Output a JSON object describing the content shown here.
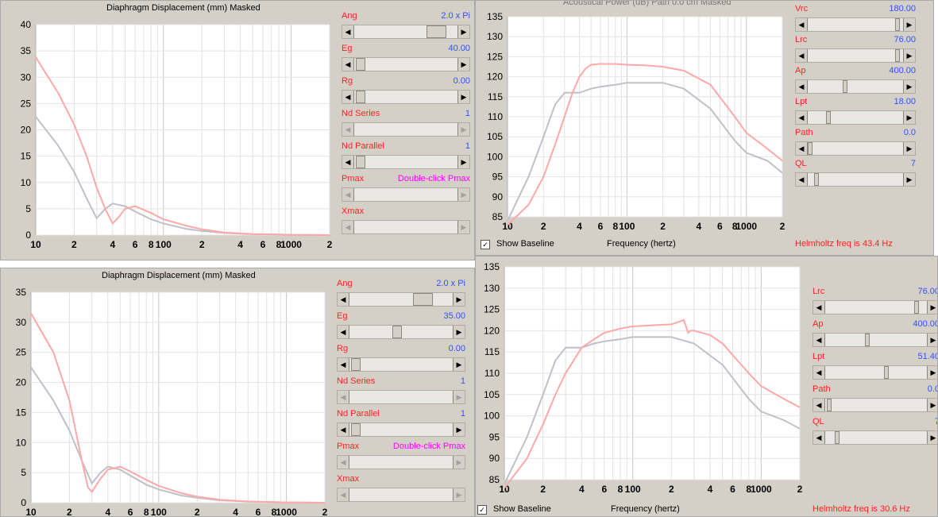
{
  "colors": {
    "baseline": "#c0c0c8",
    "current": "#ffa8a8",
    "label": "#ff2020",
    "value": "#3050ff",
    "magenta": "#ff00ff"
  },
  "xTicks": [
    "10",
    "2",
    "4",
    "6",
    "8",
    "100",
    "2",
    "4",
    "6",
    "8",
    "1000",
    "2"
  ],
  "disp_tl": {
    "title": "Diaphragm Displacement (mm)   Masked",
    "yTicks": [
      "40",
      "35",
      "30",
      "25",
      "20",
      "15",
      "10",
      "5",
      "0"
    ],
    "controls": [
      {
        "label": "Ang",
        "value": "2.0 x Pi"
      },
      {
        "label": "Eg",
        "value": "40.00"
      },
      {
        "label": "Rg",
        "value": "0.00"
      },
      {
        "label": "Nd  Series",
        "value": "1"
      },
      {
        "label": "Nd  Parallel",
        "value": "1"
      },
      {
        "label": "Pmax",
        "value": "Double-click Pmax"
      },
      {
        "label": "Xmax",
        "value": ""
      }
    ]
  },
  "disp_bl": {
    "title": "Diaphragm Displacement (mm)   Masked",
    "yTicks": [
      "35",
      "30",
      "25",
      "20",
      "15",
      "10",
      "5",
      "0"
    ],
    "controls": [
      {
        "label": "Ang",
        "value": "2.0 x Pi"
      },
      {
        "label": "Eg",
        "value": "35.00"
      },
      {
        "label": "Rg",
        "value": "0.00"
      },
      {
        "label": "Nd  Series",
        "value": "1"
      },
      {
        "label": "Nd  Parallel",
        "value": "1"
      },
      {
        "label": "Pmax",
        "value": "Double-click Pmax"
      },
      {
        "label": "Xmax",
        "value": ""
      }
    ]
  },
  "power_tr": {
    "title": "Acoustical Power (dB)   Path 0.0 cm   Masked",
    "yTicks": [
      "135",
      "130",
      "125",
      "120",
      "115",
      "110",
      "105",
      "100",
      "95",
      "90",
      "85"
    ],
    "xlabel": "Frequency (hertz)",
    "baseline_label": "Show Baseline",
    "helmholtz": "Helmholtz freq is 43.4 Hz",
    "controls": [
      {
        "label": "Vrc",
        "value": "180.00"
      },
      {
        "label": "Lrc",
        "value": "76.00"
      },
      {
        "label": "Ap",
        "value": "400.00"
      },
      {
        "label": "Lpt",
        "value": "18.00"
      },
      {
        "label": "Path",
        "value": "0.0"
      },
      {
        "label": "QL",
        "value": "7"
      }
    ]
  },
  "power_br": {
    "yTicks": [
      "135",
      "130",
      "125",
      "120",
      "115",
      "110",
      "105",
      "100",
      "95",
      "90",
      "85"
    ],
    "xlabel": "Frequency (hertz)",
    "baseline_label": "Show Baseline",
    "helmholtz": "Helmholtz freq is 30.6 Hz",
    "controls": [
      {
        "label": "Lrc",
        "value": "76.00"
      },
      {
        "label": "Ap",
        "value": "400.00"
      },
      {
        "label": "Lpt",
        "value": "51.40"
      },
      {
        "label": "Path",
        "value": "0.0"
      },
      {
        "label": "QL",
        "value": "7"
      }
    ]
  },
  "chart_data": [
    {
      "type": "line",
      "title": "Diaphragm Displacement (mm)   Masked",
      "ylim": [
        0,
        40
      ],
      "xlim": [
        10,
        2000
      ],
      "series": [
        {
          "x": [
            10,
            15,
            20,
            25,
            30,
            35,
            40,
            50,
            60,
            80,
            100,
            150,
            200,
            300,
            500,
            800,
            1000,
            2000
          ],
          "values": [
            22.5,
            17,
            12,
            7,
            3.2,
            5,
            6,
            5.5,
            4.5,
            3,
            2.2,
            1.2,
            0.8,
            0.4,
            0.2,
            0.1,
            0.05,
            0
          ]
        },
        {
          "x": [
            10,
            15,
            20,
            25,
            30,
            35,
            40,
            45,
            50,
            60,
            80,
            100,
            150,
            200,
            300,
            500,
            800,
            1000,
            2000
          ],
          "values": [
            33.8,
            27,
            21,
            15,
            9,
            5,
            2.2,
            3.5,
            5,
            5.5,
            4.2,
            3,
            1.8,
            1.1,
            0.5,
            0.2,
            0.1,
            0.05,
            0
          ]
        }
      ]
    },
    {
      "type": "line",
      "title": "Acoustical Power (dB)   Path 0.0 cm   Masked",
      "ylim": [
        85,
        135
      ],
      "xlim": [
        10,
        2000
      ],
      "series": [
        {
          "x": [
            10,
            15,
            20,
            25,
            30,
            35,
            40,
            50,
            60,
            80,
            100,
            150,
            200,
            300,
            500,
            800,
            1000,
            1500,
            2000
          ],
          "values": [
            84,
            95,
            105,
            113,
            116,
            116,
            116,
            117,
            117.5,
            118,
            118.5,
            118.5,
            118.5,
            117,
            112,
            104,
            101,
            99,
            96
          ]
        },
        {
          "x": [
            10,
            15,
            20,
            25,
            30,
            35,
            40,
            45,
            50,
            60,
            80,
            100,
            150,
            200,
            300,
            500,
            800,
            1000,
            1500,
            2000
          ],
          "values": [
            82,
            88,
            95,
            103,
            110,
            116,
            120,
            122,
            123,
            123.2,
            123.2,
            123,
            122.8,
            122.5,
            121.5,
            118,
            110,
            106,
            102,
            99
          ]
        }
      ]
    },
    {
      "type": "line",
      "title": "Diaphragm Displacement (mm)   Masked",
      "ylim": [
        0,
        35
      ],
      "xlim": [
        10,
        2000
      ],
      "series": [
        {
          "x": [
            10,
            15,
            20,
            25,
            30,
            35,
            40,
            50,
            60,
            80,
            100,
            150,
            200,
            300,
            500,
            800,
            1000,
            2000
          ],
          "values": [
            22.5,
            17,
            12,
            7,
            3.2,
            5,
            6,
            5.5,
            4.5,
            3,
            2.2,
            1.2,
            0.8,
            0.4,
            0.2,
            0.1,
            0.05,
            0
          ]
        },
        {
          "x": [
            10,
            15,
            20,
            25,
            28,
            30,
            35,
            40,
            50,
            60,
            80,
            100,
            150,
            200,
            300,
            500,
            800,
            1000,
            2000
          ],
          "values": [
            31.5,
            25,
            17,
            7,
            2.5,
            1.8,
            4,
            5.5,
            6,
            5.2,
            3.8,
            2.8,
            1.6,
            1,
            0.5,
            0.2,
            0.1,
            0.05,
            0
          ]
        }
      ]
    },
    {
      "type": "line",
      "ylim": [
        85,
        135
      ],
      "xlim": [
        10,
        2000
      ],
      "series": [
        {
          "x": [
            10,
            15,
            20,
            25,
            30,
            35,
            40,
            50,
            60,
            80,
            100,
            150,
            200,
            300,
            500,
            800,
            1000,
            1500,
            2000
          ],
          "values": [
            84,
            95,
            105,
            113,
            116,
            116,
            116,
            117,
            117.5,
            118,
            118.5,
            118.5,
            118.5,
            117,
            112,
            104,
            101,
            99,
            97
          ]
        },
        {
          "x": [
            10,
            15,
            20,
            25,
            30,
            40,
            50,
            60,
            80,
            100,
            150,
            200,
            250,
            270,
            280,
            300,
            400,
            500,
            800,
            1000,
            1500,
            2000
          ],
          "values": [
            82,
            90,
            98,
            105,
            110,
            116,
            118,
            119.5,
            120.5,
            121,
            121.3,
            121.5,
            122.5,
            119.5,
            120,
            120,
            119,
            117,
            110,
            107,
            104,
            102
          ]
        }
      ]
    }
  ]
}
